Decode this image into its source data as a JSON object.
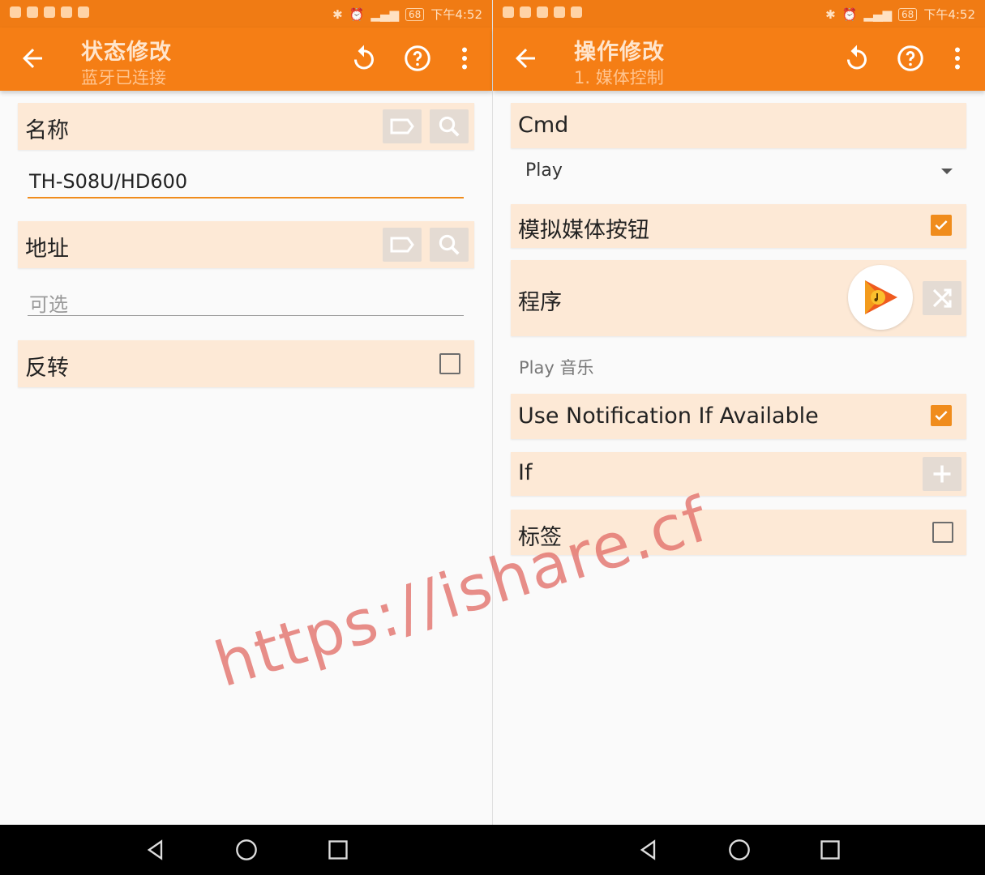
{
  "status_bar": {
    "time": "下午4:52",
    "battery": "68"
  },
  "left": {
    "toolbar": {
      "title": "状态修改",
      "subtitle": "蓝牙已连接"
    },
    "name_label": "名称",
    "name_value": "TH-S08U/HD600",
    "address_label": "地址",
    "address_placeholder": "可选",
    "invert_label": "反转"
  },
  "right": {
    "toolbar": {
      "title": "操作修改",
      "subtitle": "1. 媒体控制"
    },
    "cmd_label": "Cmd",
    "cmd_value": "Play",
    "simulate_label": "模拟媒体按钮",
    "program_label": "程序",
    "program_value": "Play 音乐",
    "notification_label": "Use Notification If Available",
    "if_label": "If",
    "tag_label": "标签"
  },
  "watermark": "https://ishare.cf",
  "colors": {
    "accent": "#f57e15",
    "card": "#fde9d6",
    "checkbox": "#f08c1c"
  }
}
